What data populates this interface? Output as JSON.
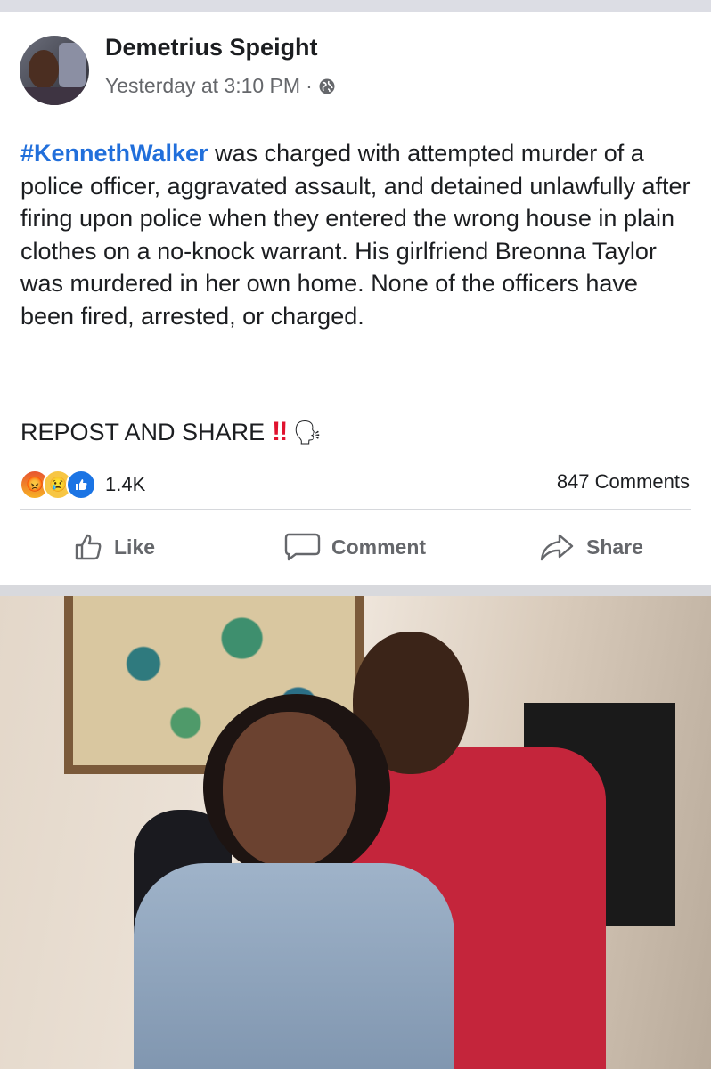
{
  "post": {
    "author": "Demetrius Speight",
    "timestamp": "Yesterday at 3:10 PM",
    "dot": "·",
    "hashtag": "#KennethWalker",
    "body": " was charged with attempted murder of a police officer, aggravated assault, and detained unlawfully after firing upon police when they entered the wrong house in plain clothes on a no-knock warrant. His girlfriend Breonna Taylor was murdered in her own home. None of the officers have been fired, arrested, or charged.",
    "cta": "REPOST AND SHARE",
    "cta_emoji": "‼",
    "cta_emoji2": "🗣"
  },
  "reactions": {
    "icons": [
      "angry-react-icon",
      "sad-react-icon",
      "like-react-icon"
    ],
    "count": "1.4K",
    "comments": "847 Comments"
  },
  "actions": {
    "like": "Like",
    "comment": "Comment",
    "share": "Share"
  },
  "colors": {
    "hashtag": "#216fdb",
    "text": "#1c1e21",
    "secondary": "#65676b",
    "cta_emoji": "#e0122e"
  }
}
